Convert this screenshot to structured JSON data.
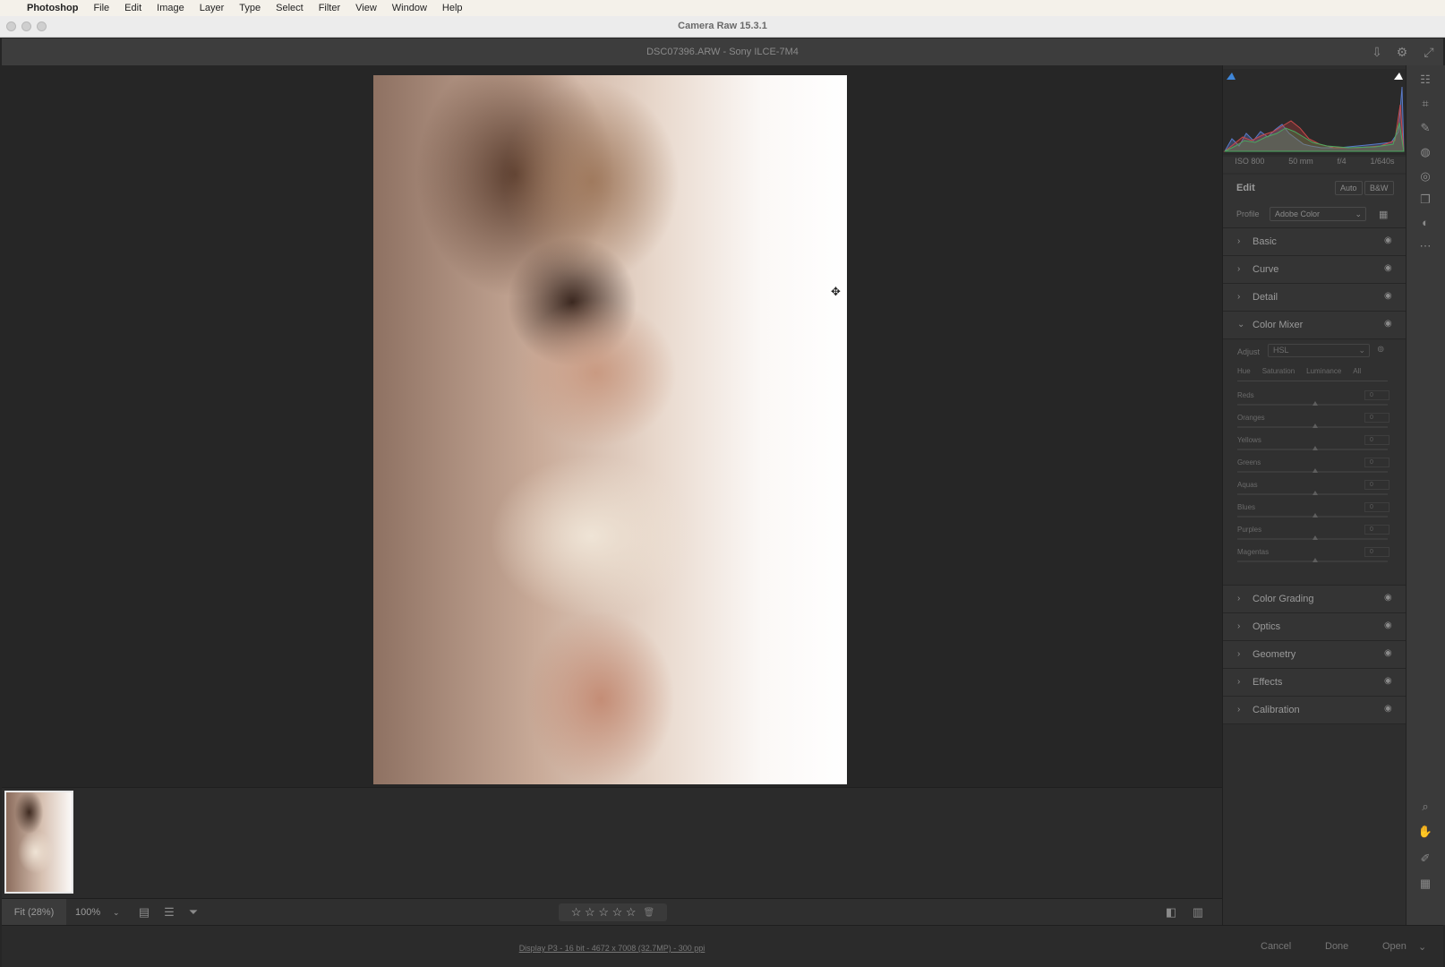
{
  "menubar": {
    "app_name": "Photoshop",
    "items": [
      "File",
      "Edit",
      "Image",
      "Layer",
      "Type",
      "Select",
      "Filter",
      "View",
      "Window",
      "Help"
    ]
  },
  "window": {
    "title": "Camera Raw 15.3.1"
  },
  "file": {
    "name": "DSC07396.ARW  -  Sony ILCE-7M4"
  },
  "toolbar": {
    "fit_label": "Fit (28%)",
    "zoom_label": "100%",
    "rating_stars": "☆ ☆ ☆ ☆ ☆",
    "trash_label": "🗑"
  },
  "workflow": {
    "label": "Display P3 - 16 bit - 4672 x 7008 (32.7MP) - 300 ppi"
  },
  "actions": {
    "cancel": "Cancel",
    "done": "Done",
    "open": "Open"
  },
  "exif": {
    "iso": "ISO 800",
    "focal": "50 mm",
    "aperture": "f/4",
    "shutter": "1/640s"
  },
  "edit": {
    "title": "Edit",
    "auto_label": "Auto",
    "bw_label": "B&W",
    "profile_label": "Profile",
    "profile_value": "Adobe Color"
  },
  "sections": [
    {
      "label": "Basic"
    },
    {
      "label": "Curve"
    },
    {
      "label": "Detail"
    },
    {
      "label": "Color Mixer"
    },
    {
      "label": "Color Grading"
    },
    {
      "label": "Optics"
    },
    {
      "label": "Geometry"
    },
    {
      "label": "Effects"
    },
    {
      "label": "Calibration"
    }
  ],
  "color_mixer": {
    "adjust_label": "Adjust",
    "adjust_value": "HSL",
    "tabs": [
      "Hue",
      "Saturation",
      "Luminance",
      "All"
    ],
    "sliders": [
      {
        "name": "Reds",
        "value": "0"
      },
      {
        "name": "Oranges",
        "value": "0"
      },
      {
        "name": "Yellows",
        "value": "0"
      },
      {
        "name": "Greens",
        "value": "0"
      },
      {
        "name": "Aquas",
        "value": "0"
      },
      {
        "name": "Blues",
        "value": "0"
      },
      {
        "name": "Purples",
        "value": "0"
      },
      {
        "name": "Magentas",
        "value": "0"
      }
    ]
  },
  "icons": {
    "apple": "apple-icon",
    "save": "save-icon",
    "settings": "gear-icon",
    "fullscreen": "fullscreen-icon",
    "eye": "eye-icon"
  },
  "colors": {
    "panel_bg": "#2e2e2e",
    "canvas_bg": "#262626",
    "text_dim": "#9a9a9a"
  }
}
